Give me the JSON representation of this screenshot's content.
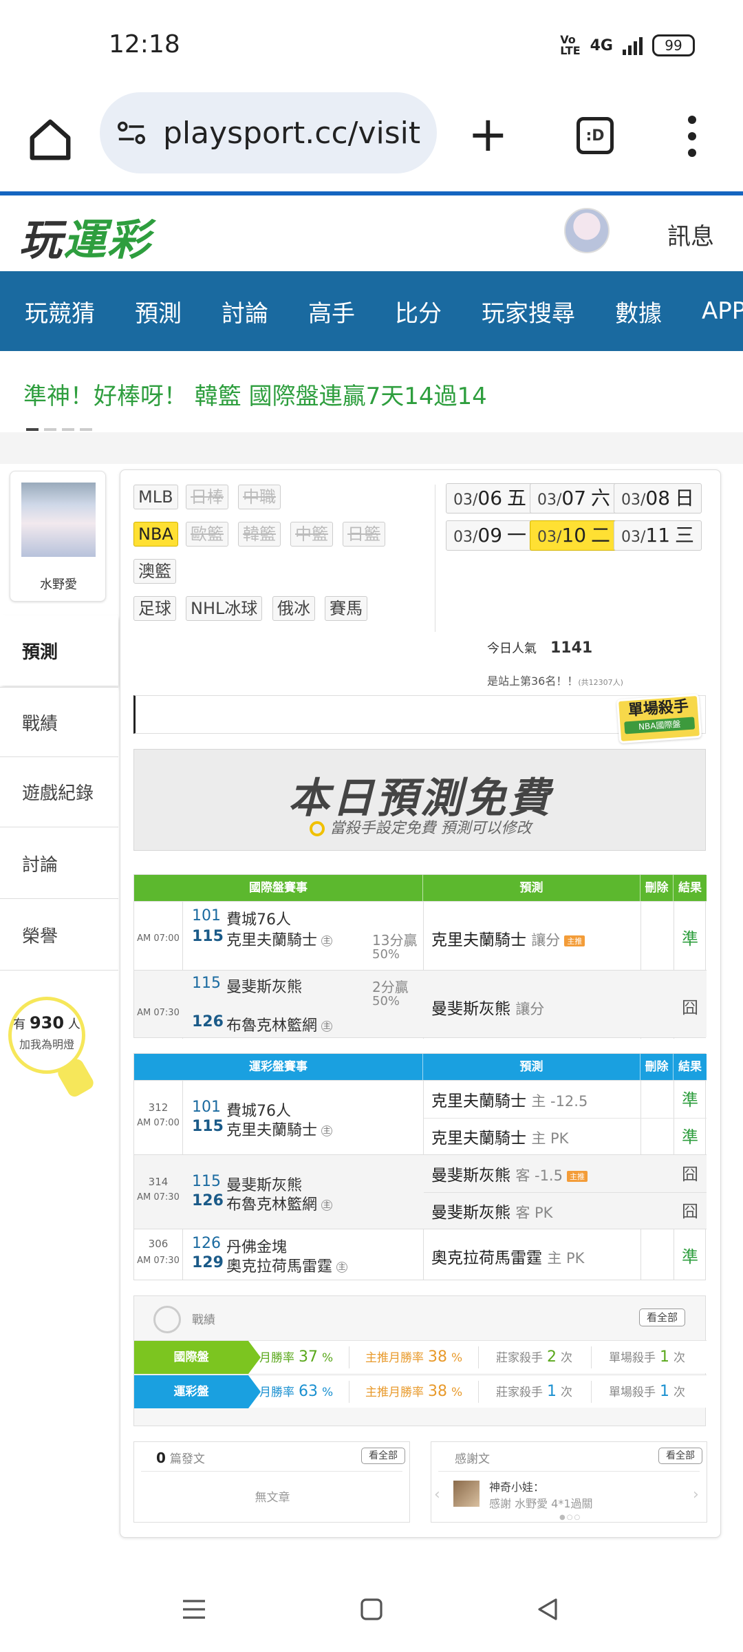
{
  "status": {
    "time": "12:18",
    "network": "4G",
    "battery": "99"
  },
  "browser": {
    "url": "playsport.cc/visit",
    "tabs_label": ":D"
  },
  "site": {
    "logo_a": "玩",
    "logo_b": "運彩",
    "message": "訊息"
  },
  "nav": [
    "玩競猜",
    "預測",
    "討論",
    "高手",
    "比分",
    "玩家搜尋",
    "數據",
    "APP"
  ],
  "ticker": "準神！好棒呀！ 韓籃 國際盤連贏7天14過14",
  "profile": {
    "name": "水野愛"
  },
  "sidebar": [
    "預測",
    "戰績",
    "遊戲紀錄",
    "討論",
    "榮譽"
  ],
  "fans": {
    "prefix": "有",
    "count": "930",
    "suffix": "人",
    "sub": "加我為明燈"
  },
  "leagues": {
    "row1": [
      "MLB",
      "日棒",
      "中職"
    ],
    "row2": [
      "NBA",
      "歐籃",
      "韓籃",
      "中籃",
      "日籃"
    ],
    "row3": [
      "澳籃"
    ],
    "row4": [
      "足球",
      "NHL冰球",
      "俄冰",
      "賽馬"
    ]
  },
  "dates": [
    {
      "md": "03/",
      "d": "06",
      "w": "五"
    },
    {
      "md": "03/",
      "d": "07",
      "w": "六"
    },
    {
      "md": "03/",
      "d": "08",
      "w": "日"
    },
    {
      "md": "03/",
      "d": "09",
      "w": "一"
    },
    {
      "md": "03/",
      "d": "10",
      "w": "二"
    },
    {
      "md": "03/",
      "d": "11",
      "w": "三"
    }
  ],
  "popularity": {
    "label": "今日人氣",
    "value": "1141",
    "rank": "是站上第36名！！",
    "total": "(共12307人)"
  },
  "killer_badge": {
    "title": "單場殺手",
    "sub": "NBA國際盤"
  },
  "banner": {
    "title": "本日預測免費",
    "sub": "當殺手設定免費  預測可以修改"
  },
  "intl": {
    "headers": {
      "game": "國際盤賽事",
      "pred": "預測",
      "del": "刪除",
      "result": "結果"
    },
    "rows": [
      {
        "time": "AM 07:00",
        "n1": "101",
        "t1": "費城76人",
        "n2": "115",
        "t2": "克里夫蘭騎士",
        "home": "主",
        "spread": "13分贏",
        "pct": "50%",
        "pred": "克里夫蘭騎士",
        "ptype": "讓分",
        "hot": "主推",
        "result": "準"
      },
      {
        "time": "AM 07:30",
        "n1": "115",
        "t1": "曼斐斯灰熊",
        "n2": "126",
        "t2": "布魯克林籃網",
        "home": "主",
        "spread": "2分贏",
        "pct": "50%",
        "pred": "曼斐斯灰熊",
        "ptype": "讓分",
        "result": "囧"
      }
    ]
  },
  "local": {
    "headers": {
      "game": "運彩盤賽事",
      "pred": "預測",
      "del": "刪除",
      "result": "結果"
    },
    "rows": [
      {
        "code": "312",
        "time": "AM 07:00",
        "n1": "101",
        "t1": "費城76人",
        "n2": "115",
        "t2": "克里夫蘭騎士",
        "home": "主",
        "preds": [
          {
            "team": "克里夫蘭騎士",
            "sub": "主 -12.5",
            "result": "準"
          },
          {
            "team": "克里夫蘭騎士",
            "sub": "主 PK",
            "result": "準"
          }
        ]
      },
      {
        "code": "314",
        "time": "AM 07:30",
        "n1": "115",
        "t1": "曼斐斯灰熊",
        "n2": "126",
        "t2": "布魯克林籃網",
        "home": "主",
        "preds": [
          {
            "team": "曼斐斯灰熊",
            "sub": "客 -1.5",
            "hot": "主推",
            "result": "囧"
          },
          {
            "team": "曼斐斯灰熊",
            "sub": "客 PK",
            "result": "囧"
          }
        ]
      },
      {
        "code": "306",
        "time": "AM 07:30",
        "n1": "126",
        "t1": "丹佛金塊",
        "n2": "129",
        "t2": "奧克拉荷馬雷霆",
        "home": "主",
        "preds": [
          {
            "team": "奧克拉荷馬雷霆",
            "sub": "主 PK",
            "result": "準"
          }
        ]
      }
    ]
  },
  "record": {
    "title": "戰績",
    "view_all": "看全部",
    "rows": [
      {
        "label": "國際盤",
        "m_label": "月勝率",
        "m_val": "37",
        "pct": "%",
        "z_label": "主推月勝率",
        "z_val": "38",
        "k_label": "莊家殺手",
        "k_val": "2",
        "k_unit": "次",
        "s_label": "單場殺手",
        "s_val": "1",
        "s_unit": "次"
      },
      {
        "label": "運彩盤",
        "m_label": "月勝率",
        "m_val": "63",
        "pct": "%",
        "z_label": "主推月勝率",
        "z_val": "38",
        "k_label": "莊家殺手",
        "k_val": "1",
        "k_unit": "次",
        "s_label": "單場殺手",
        "s_val": "1",
        "s_unit": "次"
      }
    ]
  },
  "posts": {
    "count": "0",
    "label": "篇發文",
    "view_all": "看全部",
    "empty": "無文章"
  },
  "thanks": {
    "label": "感謝文",
    "view_all": "看全部",
    "user": "神奇小娃：",
    "text": "感謝 水野愛 4*1過關"
  },
  "colors": {
    "nav": "#1a6aa0",
    "green": "#2e9e3e",
    "intl_head": "#5cb82e",
    "local_head": "#1aa0e0",
    "select": "#ffe033"
  }
}
